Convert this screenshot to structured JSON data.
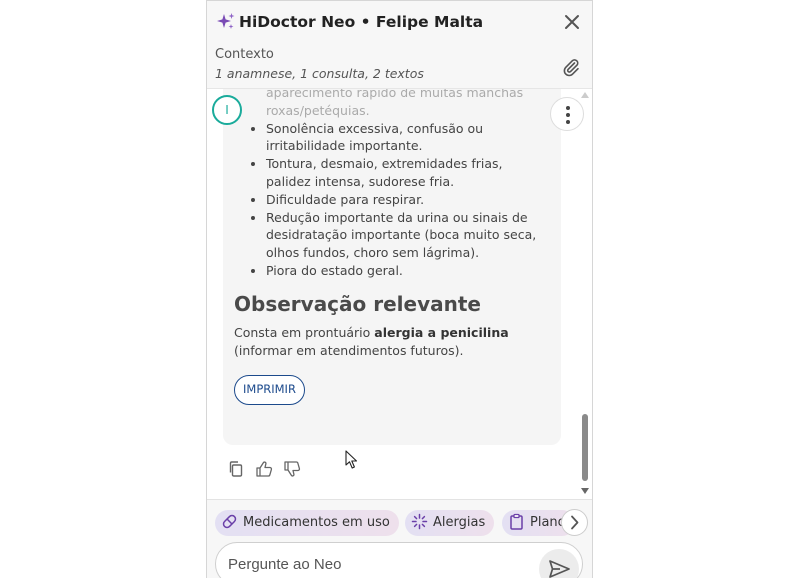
{
  "header": {
    "title": "HiDoctor Neo • Felipe Malta",
    "context_label": "Contexto",
    "context_summary": "1 anamnese, 1 consulta, 2 textos",
    "icons": {
      "sparkle": "sparkle-icon",
      "close": "close-icon",
      "attach": "paperclip-icon"
    }
  },
  "message": {
    "avatar_letter": "I",
    "bullets": [
      "Sangramento (nariz, gengiva, vômitos com sangue, fezes escuras, sangue na urina) ou aparecimento rápido de muitas manchas roxas/petéquias.",
      "Sonolência excessiva, confusão ou irritabilidade importante.",
      "Tontura, desmaio, extremidades frias, palidez intensa, sudorese fria.",
      "Dificuldade para respirar.",
      "Redução importante da urina ou sinais de desidratação importante (boca muito seca, olhos fundos, choro sem lágrima).",
      "Piora do estado geral."
    ],
    "observation_title": "Observação relevante",
    "observation_prefix": "Consta em prontuário ",
    "observation_bold": "alergia a penicilina",
    "observation_suffix": " (informar em atendimentos futuros).",
    "print_label": "IMPRIMIR"
  },
  "actions": {
    "copy": "copy-icon",
    "like": "thumbs-up-icon",
    "dislike": "thumbs-down-icon"
  },
  "chips": [
    {
      "label": "Medicamentos em uso",
      "icon": "pill-icon"
    },
    {
      "label": "Alergias",
      "icon": "sparkle-burst-icon"
    },
    {
      "label": "Plano",
      "icon": "clipboard-icon"
    }
  ],
  "input": {
    "placeholder": "Pergunte ao Neo"
  },
  "colors": {
    "accent_teal": "#1aab9b",
    "print_blue": "#1c4a8c",
    "sparkle_purple": "#7a4bb5",
    "chip_purple": "#6a3fa8"
  }
}
